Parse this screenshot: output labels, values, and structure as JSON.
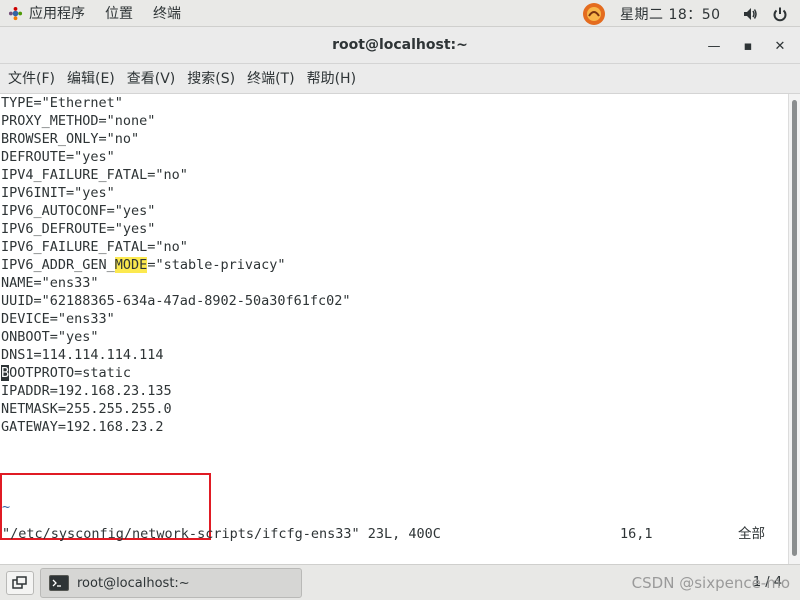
{
  "topbar": {
    "apps_label": "应用程序",
    "places_label": "位置",
    "terminal_label": "终端",
    "clock": "星期二 18：50"
  },
  "window": {
    "title": "root@localhost:~",
    "minimize_glyph": "—",
    "maximize_glyph": "▪",
    "close_glyph": "✕"
  },
  "menubar": {
    "file": "文件(F)",
    "edit": "编辑(E)",
    "view": "查看(V)",
    "search": "搜索(S)",
    "terminal": "终端(T)",
    "help": "帮助(H)"
  },
  "terminal": {
    "lines": [
      "TYPE=\"Ethernet\"",
      "PROXY_METHOD=\"none\"",
      "BROWSER_ONLY=\"no\"",
      "DEFROUTE=\"yes\"",
      "IPV4_FAILURE_FATAL=\"no\"",
      "IPV6INIT=\"yes\"",
      "IPV6_AUTOCONF=\"yes\"",
      "IPV6_DEFROUTE=\"yes\"",
      "IPV6_FAILURE_FATAL=\"no\"",
      "IPV6_ADDR_GEN_",
      "NAME=\"ens33\"",
      "UUID=\"62188365-634a-47ad-8902-50a30f61fc02\"",
      "DEVICE=\"ens33\"",
      "ONBOOT=\"yes\"",
      "DNS1=114.114.114.114",
      "",
      "IPADDR=192.168.23.135",
      "NETMASK=255.255.255.0",
      "GATEWAY=192.168.23.2"
    ],
    "search_highlight": "MODE",
    "line10_tail": "=\"stable-privacy\"",
    "cursor_char": "B",
    "line16_tail": "OOTPROTO=static",
    "tilde": "~",
    "status_file": "\"/etc/sysconfig/network-scripts/ifcfg-ens33\" 23L, 400C",
    "status_position": "16,1",
    "status_percent": "全部"
  },
  "taskbar": {
    "task_label": "root@localhost:~",
    "workspace": "1 / 4",
    "watermark": "CSDN @sixpence-mo"
  },
  "colors": {
    "highlight_box": "#e01b24",
    "search_highlight": "#fce94f"
  }
}
